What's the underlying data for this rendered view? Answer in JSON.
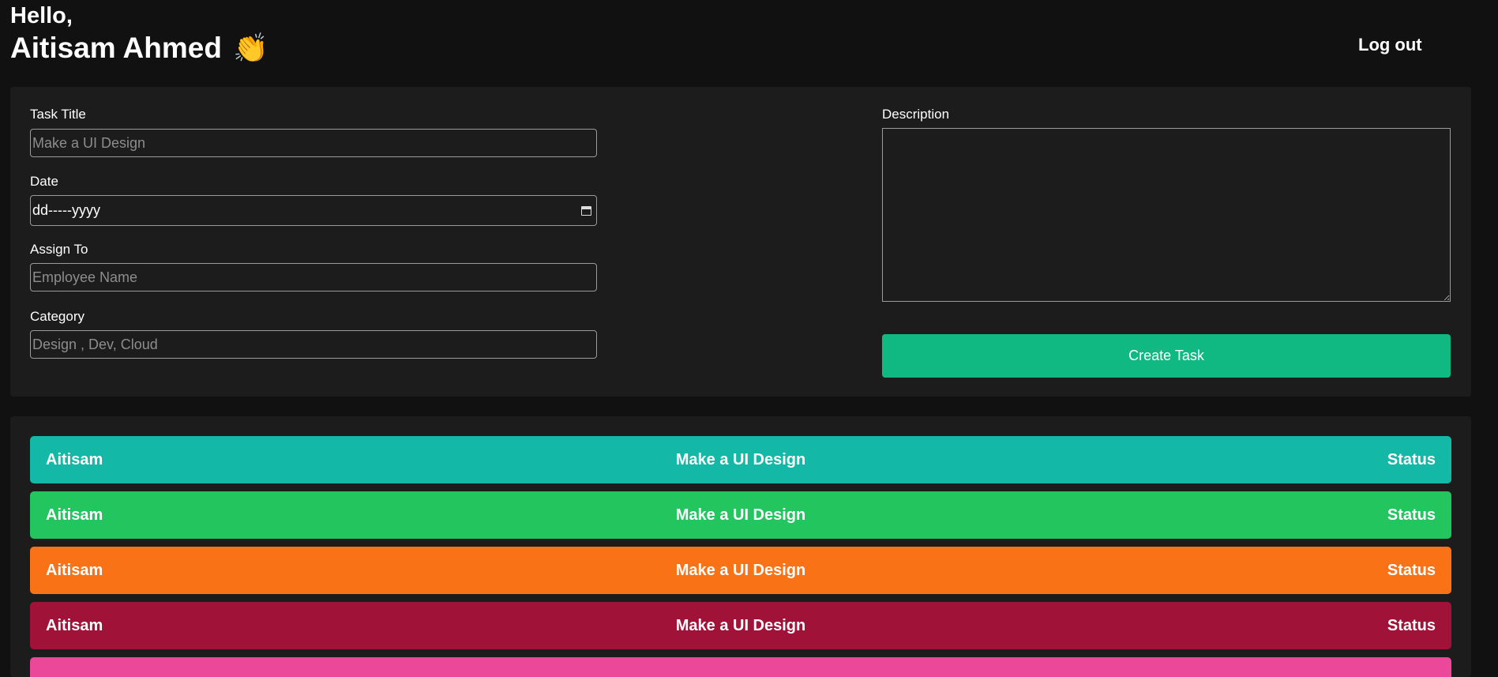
{
  "header": {
    "greeting": "Hello,",
    "user_name": "Aitisam Ahmed",
    "wave_emoji": "👏",
    "logout_label": "Log out"
  },
  "form": {
    "title_label": "Task Title",
    "title_placeholder": "Make a UI Design",
    "date_label": "Date",
    "date_placeholder": "dd-----yyyy",
    "assign_label": "Assign To",
    "assign_placeholder": "Employee Name",
    "category_label": "Category",
    "category_placeholder": "Design , Dev, Cloud",
    "description_label": "Description",
    "create_button_label": "Create Task"
  },
  "tasks": [
    {
      "name": "Aitisam",
      "title": "Make a UI Design",
      "status": "Status",
      "color": "#14b8a6"
    },
    {
      "name": "Aitisam",
      "title": "Make a UI Design",
      "status": "Status",
      "color": "#22c55e"
    },
    {
      "name": "Aitisam",
      "title": "Make a UI Design",
      "status": "Status",
      "color": "#f97316"
    },
    {
      "name": "Aitisam",
      "title": "Make a UI Design",
      "status": "Status",
      "color": "#a11239"
    },
    {
      "name": "",
      "title": "",
      "status": "",
      "color": "#ec4899"
    }
  ],
  "colors": {
    "background": "#111111",
    "panel": "#1c1c1c",
    "accent": "#10b981"
  }
}
